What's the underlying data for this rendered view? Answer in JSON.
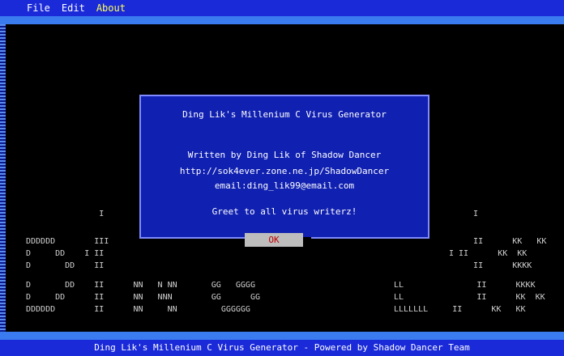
{
  "menu": {
    "items": [
      "File",
      "Edit",
      "About"
    ],
    "active": "About"
  },
  "dialog": {
    "title": "Ding Lik's Millenium C Virus Generator",
    "line1": "Written by Ding Lik of Shadow Dancer",
    "line2": "http://sok4ever.zone.ne.jp/ShadowDancer",
    "line3": "email:ding_lik99@email.com",
    "line4": "Greet to all virus writerz!",
    "ok_label": "OK"
  },
  "background_art": {
    "lines": [
      "               I",
      "DDDDDD        III",
      "D     DD    I II",
      "D       DD    II",
      "D       DD    II      NN   N NN       GG   GGGG",
      "D     DD      II      NN   NNN        GG      GG",
      "DDDDDD        II      NN     NN         GGGGGG"
    ],
    "right_lines": [
      "   I",
      "   II      KK   KK",
      "I II      KK  KK",
      "   II      KKKK",
      "LL               II      KKKK",
      "LL               II      KK  KK",
      "LLLLLLL     II      KK   KK"
    ]
  },
  "status": {
    "text": "Ding Lik's Millenium C Virus Generator - Powered by Shadow Dancer Team"
  },
  "colors": {
    "blue_bar": "#1a2ad8",
    "light_strip": "#3a7cf0",
    "dialog_bg": "#1020b0",
    "button_bg": "#bdbdbd",
    "button_text": "#c00000"
  }
}
